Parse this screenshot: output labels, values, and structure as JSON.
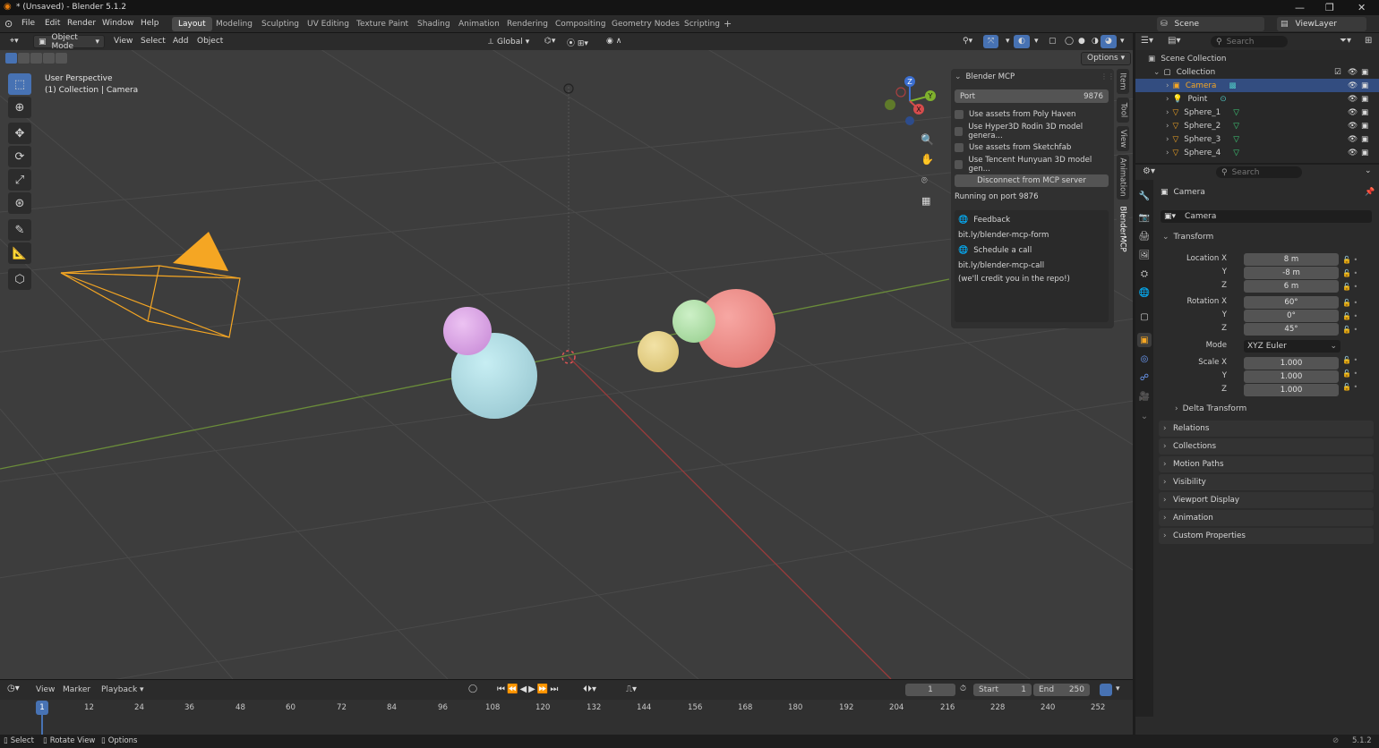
{
  "window": {
    "title": "* (Unsaved) - Blender 5.1.2",
    "controls": [
      "—",
      "❐",
      "✕"
    ]
  },
  "topbar": {
    "menus": [
      "File",
      "Edit",
      "Render",
      "Window",
      "Help"
    ],
    "workspaces": [
      "Layout",
      "Modeling",
      "Sculpting",
      "UV Editing",
      "Texture Paint",
      "Shading",
      "Animation",
      "Rendering",
      "Compositing",
      "Geometry Nodes",
      "Scripting"
    ],
    "active_workspace": "Layout",
    "add_tab": "+",
    "scene": "Scene",
    "view_layer": "ViewLayer"
  },
  "viewport": {
    "mode": "Object Mode",
    "menus": [
      "View",
      "Select",
      "Add",
      "Object"
    ],
    "orientation": "Global",
    "options_label": "Options",
    "overlay_line1": "User Perspective",
    "overlay_line2": "(1) Collection | Camera",
    "gizmo": {
      "x": "X",
      "y": "Y",
      "z": "Z"
    }
  },
  "mcp_panel": {
    "title": "Blender MCP",
    "port_label": "Port",
    "port_value": "9876",
    "options": [
      "Use assets from Poly Haven",
      "Use Hyper3D Rodin 3D model genera...",
      "Use assets from Sketchfab",
      "Use Tencent Hunyuan 3D model gen..."
    ],
    "disconnect_label": "Disconnect from MCP server",
    "status": "Running on port 9876",
    "feedback_label": "Feedback",
    "feedback_link": "bit.ly/blender-mcp-form",
    "call_label": "Schedule a call",
    "call_link": "bit.ly/blender-mcp-call",
    "credit": "(we'll credit you in the repo!)"
  },
  "side_tabs": [
    "Item",
    "Tool",
    "View",
    "Animation",
    "BlenderMCP"
  ],
  "timeline": {
    "menus": [
      "View",
      "Marker",
      "Playback"
    ],
    "current_frame": "1",
    "start_label": "Start",
    "start": "1",
    "end_label": "End",
    "end": "250",
    "ticks": [
      "1",
      "12",
      "24",
      "36",
      "48",
      "60",
      "72",
      "84",
      "96",
      "108",
      "120",
      "132",
      "144",
      "156",
      "168",
      "180",
      "192",
      "204",
      "216",
      "228",
      "240",
      "252"
    ]
  },
  "statusbar": {
    "items": [
      "Select",
      "Rotate View",
      "Options"
    ],
    "version": "5.1.2"
  },
  "outliner": {
    "search_placeholder": "Search",
    "scene_collection": "Scene Collection",
    "collection": "Collection",
    "items": [
      "Camera",
      "Point",
      "Sphere_1",
      "Sphere_2",
      "Sphere_3",
      "Sphere_4"
    ],
    "selected": "Camera"
  },
  "properties": {
    "search_placeholder": "Search",
    "object_name": "Camera",
    "data_name": "Camera",
    "transform_label": "Transform",
    "location_label": "Location X",
    "location": [
      "8 m",
      "-8 m",
      "6 m"
    ],
    "rotation_label": "Rotation X",
    "rotation": [
      "60°",
      "0°",
      "45°"
    ],
    "mode_label": "Mode",
    "mode_value": "XYZ Euler",
    "scale_label": "Scale X",
    "scale": [
      "1.000",
      "1.000",
      "1.000"
    ],
    "y_label": "Y",
    "z_label": "Z",
    "delta_label": "Delta Transform",
    "panels": [
      "Relations",
      "Collections",
      "Motion Paths",
      "Visibility",
      "Viewport Display",
      "Animation",
      "Custom Properties"
    ]
  },
  "colors": {
    "accent": "#4772b3",
    "selection": "#334d80",
    "camera_orange": "#f5a623",
    "sphere_blue": "#acd8e0",
    "sphere_pink": "#dba6e6",
    "sphere_yellow": "#e8d38a",
    "sphere_green": "#b5e3ad",
    "sphere_red": "#ee8a86"
  }
}
